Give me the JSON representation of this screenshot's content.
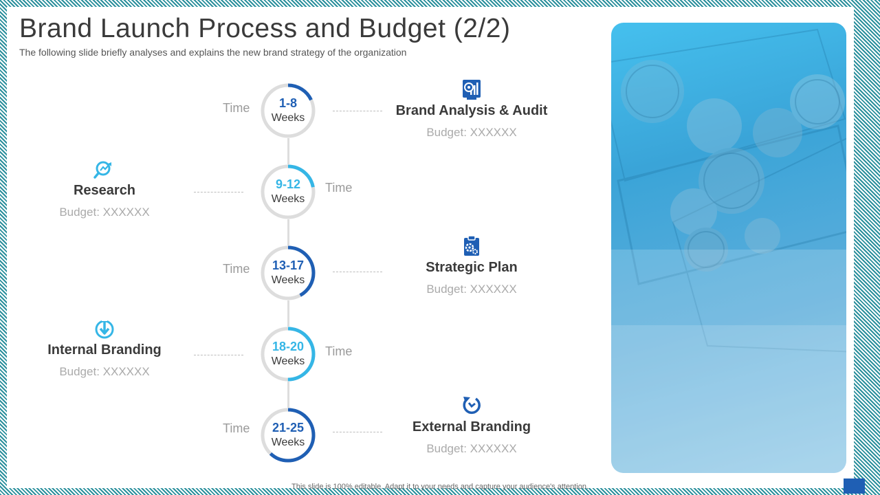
{
  "title": "Brand Launch Process and Budget (2/2)",
  "subtitle": "The following slide briefly analyses and explains the new brand strategy of the organization",
  "footer": "This slide is 100% editable. Adapt it to your needs and capture your audience's attention.",
  "colors": {
    "dark_blue": "#1f5fb4",
    "light_blue": "#35b6e6",
    "ring_grey": "#dddddd",
    "text_dark": "#3a3a3a",
    "text_muted": "#aaaaaa"
  },
  "timeline": [
    {
      "range": "1-8",
      "unit": "Weeks",
      "time_label": "Time",
      "color": "#1f5fb4",
      "step": "Brand Analysis & Audit",
      "budget": "Budget: XXXXXX",
      "icon": "analytics-monitor-icon",
      "progress": 0.18
    },
    {
      "range": "9-12",
      "unit": "Weeks",
      "time_label": "Time",
      "color": "#35b6e6",
      "step": "Research",
      "budget": "Budget: XXXXXX",
      "icon": "magnifier-chart-icon",
      "progress": 0.22
    },
    {
      "range": "13-17",
      "unit": "Weeks",
      "time_label": "Time",
      "color": "#1f5fb4",
      "step": "Strategic Plan",
      "budget": "Budget: XXXXXX",
      "icon": "clipboard-gear-icon",
      "progress": 0.42
    },
    {
      "range": "18-20",
      "unit": "Weeks",
      "time_label": "Time",
      "color": "#35b6e6",
      "step": "Internal Branding",
      "budget": "Budget: XXXXXX",
      "icon": "download-arrow-icon",
      "progress": 0.5
    },
    {
      "range": "21-25",
      "unit": "Weeks",
      "time_label": "Time",
      "color": "#1f5fb4",
      "step": "External Branding",
      "budget": "Budget: XXXXXX",
      "icon": "refresh-arrow-icon",
      "progress": 0.62
    }
  ]
}
